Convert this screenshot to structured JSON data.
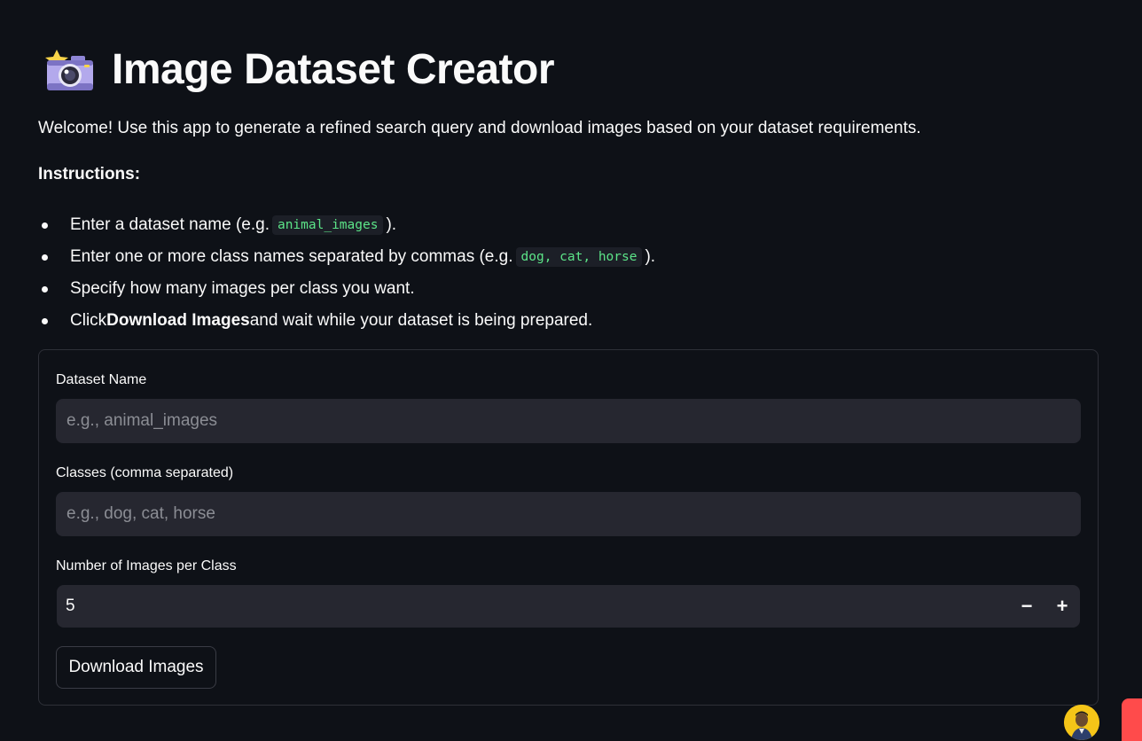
{
  "header": {
    "icon": "camera-with-flash-icon",
    "title": "Image Dataset Creator"
  },
  "welcome_text": "Welcome! Use this app to generate a refined search query and download images based on your dataset requirements.",
  "instructions": {
    "heading": "Instructions:",
    "items": [
      {
        "pre": "Enter a dataset name (e.g. ",
        "code": "animal_images",
        "post": ")."
      },
      {
        "pre": "Enter one or more class names separated by commas (e.g. ",
        "code": "dog, cat, horse",
        "post": ")."
      },
      {
        "pre": "Specify how many images per class you want."
      },
      {
        "pre": "Click ",
        "bold": "Download Images",
        "post": " and wait while your dataset is being prepared."
      }
    ]
  },
  "form": {
    "dataset_name": {
      "label": "Dataset Name",
      "placeholder": "e.g., animal_images",
      "value": ""
    },
    "classes": {
      "label": "Classes (comma separated)",
      "placeholder": "e.g., dog, cat, horse",
      "value": ""
    },
    "num_images": {
      "label": "Number of Images per Class",
      "value": "5",
      "minus": "−",
      "plus": "+"
    },
    "submit_label": "Download Images"
  },
  "colors": {
    "background": "#0e1117",
    "input_bg": "#262730",
    "code_text": "#5ce488",
    "accent_red": "#ff4b4b"
  }
}
